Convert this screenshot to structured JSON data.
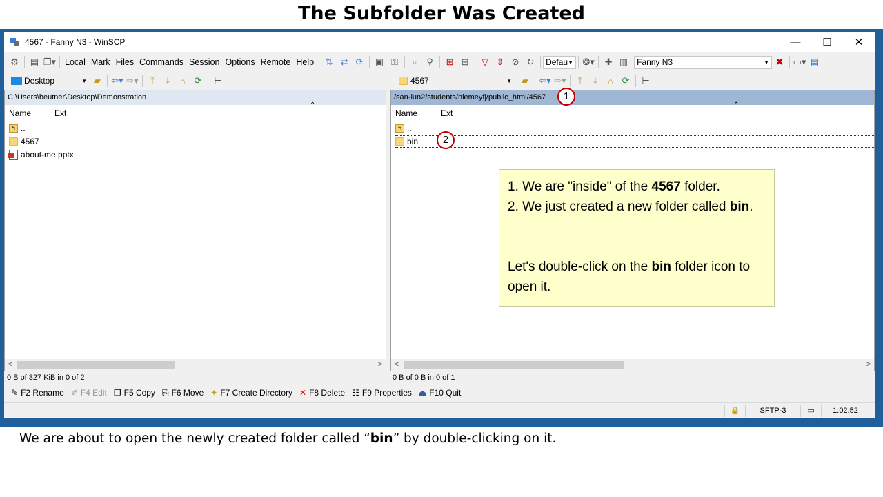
{
  "slide": {
    "title": "The Subfolder Was Created",
    "caption_before": "We are about to open the newly created folder called “",
    "caption_bold": "bin",
    "caption_after": "” by double-clicking on it."
  },
  "window": {
    "title": "4567 - Fanny N3 - WinSCP",
    "minimize": "—",
    "maximize": "☐",
    "close": "✕"
  },
  "menu": [
    "Local",
    "Mark",
    "Files",
    "Commands",
    "Session",
    "Options",
    "Remote",
    "Help"
  ],
  "toolbar": {
    "transfer_preset": "Defau",
    "session_name": "Fanny N3"
  },
  "left": {
    "drive": "Desktop",
    "path": "C:\\Users\\beutner\\Desktop\\Demonstration",
    "col_name": "Name",
    "col_ext": "Ext",
    "files": [
      "..",
      "4567",
      "about-me.pptx"
    ],
    "status": "0 B of 327 KiB in 0 of 2"
  },
  "right": {
    "dir": "4567",
    "path": "/san-lun2/students/niemeyfj/public_html/4567",
    "col_name": "Name",
    "col_ext": "Ext",
    "files": [
      "..",
      "bin"
    ],
    "status": "0 B of 0 B in 0 of 1"
  },
  "fkeys": [
    "F2 Rename",
    "F4 Edit",
    "F5 Copy",
    "F6 Move",
    "F7 Create Directory",
    "F8 Delete",
    "F9 Properties",
    "F10 Quit"
  ],
  "statusbar": {
    "protocol": "SFTP-3",
    "time": "1:02:52"
  },
  "badges": [
    "1",
    "2"
  ],
  "callout": {
    "line1_a": "1. We are \"inside\" of the ",
    "line1_b": "4567",
    "line1_c": " folder.",
    "line2_a": "2. We just created a new folder called ",
    "line2_b": "bin",
    "line2_c": ".",
    "line3_a": "Let's double-click on the ",
    "line3_b": "bin",
    "line3_c": " folder icon to open it."
  }
}
